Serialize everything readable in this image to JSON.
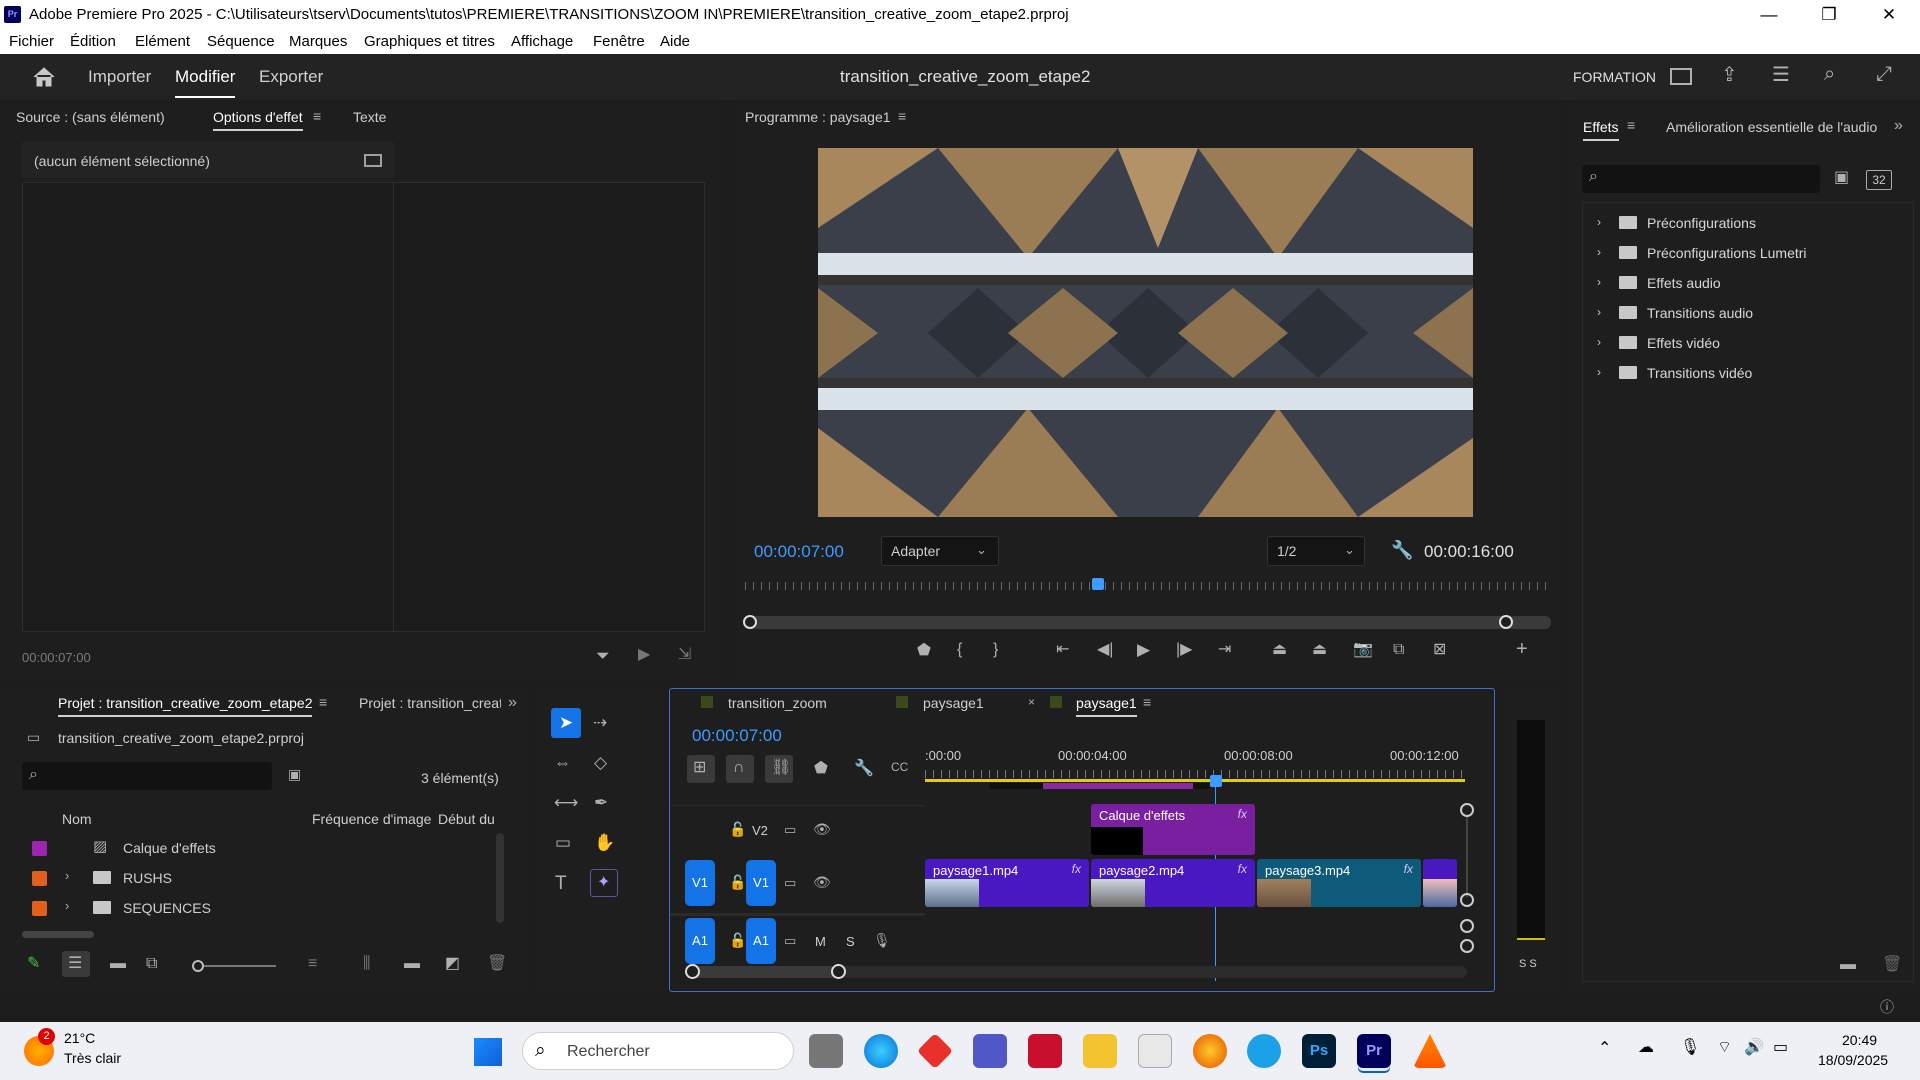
{
  "window": {
    "app_icon": "Pr",
    "title": "Adobe Premiere Pro 2025 - C:\\Utilisateurs\\tserv\\Documents\\tutos\\PREMIERE\\TRANSITIONS\\ZOOM IN\\PREMIERE\\transition_creative_zoom_etape2.prproj",
    "minimize": "—",
    "restore": "❐",
    "close": "✕"
  },
  "menu": [
    "Fichier",
    "Édition",
    "Elément",
    "Séquence",
    "Marques",
    "Graphiques et titres",
    "Affichage",
    "Fenêtre",
    "Aide"
  ],
  "header": {
    "tabs": [
      "Importer",
      "Modifier",
      "Exporter"
    ],
    "active_tab": "Modifier",
    "project_name": "transition_creative_zoom_etape2",
    "workspace": "FORMATION"
  },
  "source_panel": {
    "tabs": [
      "Source : (sans élément)",
      "Options d'effet",
      "Texte"
    ],
    "active_tab": "Options d'effet",
    "empty_text": "(aucun élément sélectionné)",
    "timecode": "00:00:07:00"
  },
  "program_monitor": {
    "title": "Programme : paysage1",
    "timecode": "00:00:07:00",
    "fit": "Adapter",
    "resolution": "1/2",
    "duration": "00:00:16:00",
    "playhead_fraction": 0.4375
  },
  "effects_panel": {
    "tabs": [
      "Effets",
      "Amélioration essentielle de l'audio"
    ],
    "active_tab": "Effets",
    "search_placeholder": "",
    "items": [
      "Préconfigurations",
      "Préconfigurations Lumetri",
      "Effets audio",
      "Transitions audio",
      "Effets vidéo",
      "Transitions vidéo"
    ],
    "badge_32": "32"
  },
  "project_panel": {
    "tabs": [
      "Projet : transition_creative_zoom_etape2",
      "Projet : transition_creat"
    ],
    "file": "transition_creative_zoom_etape2.prproj",
    "count": "3 élément(s)",
    "columns": [
      "Nom",
      "Fréquence d'image",
      "Début du"
    ],
    "rows": [
      {
        "name": "Calque d'effets",
        "color": "#9b27af",
        "type": "layer"
      },
      {
        "name": "RUSHS",
        "color": "#e0601c",
        "type": "folder"
      },
      {
        "name": "SEQUENCES",
        "color": "#e0601c",
        "type": "folder"
      }
    ]
  },
  "timeline": {
    "tabs": [
      "transition_zoom",
      "paysage1",
      "paysage1"
    ],
    "active_tab_index": 2,
    "timecode": "00:00:07:00",
    "ruler": [
      ":00:00",
      "00:00:04:00",
      "00:00:08:00",
      "00:00:12:00"
    ],
    "tracks": {
      "v2": "V2",
      "v1_src": "V1",
      "v1": "V1",
      "a1_src": "A1",
      "a1": "A1",
      "m": "M",
      "s": "S"
    },
    "clips_v2": [
      {
        "name": "Calque d'effets",
        "fx": "fx"
      }
    ],
    "clips_v1": [
      {
        "name": "paysage1.mp4",
        "fx": "fx"
      },
      {
        "name": "paysage2.mp4",
        "fx": "fx"
      },
      {
        "name": "paysage3.mp4",
        "fx": "fx"
      }
    ]
  },
  "meters": {
    "labels": "S S"
  },
  "taskbar": {
    "weather_temp": "21°C",
    "weather_desc": "Très clair",
    "weather_badge": "2",
    "search": "Rechercher",
    "time": "20:49",
    "date": "18/09/2025"
  }
}
